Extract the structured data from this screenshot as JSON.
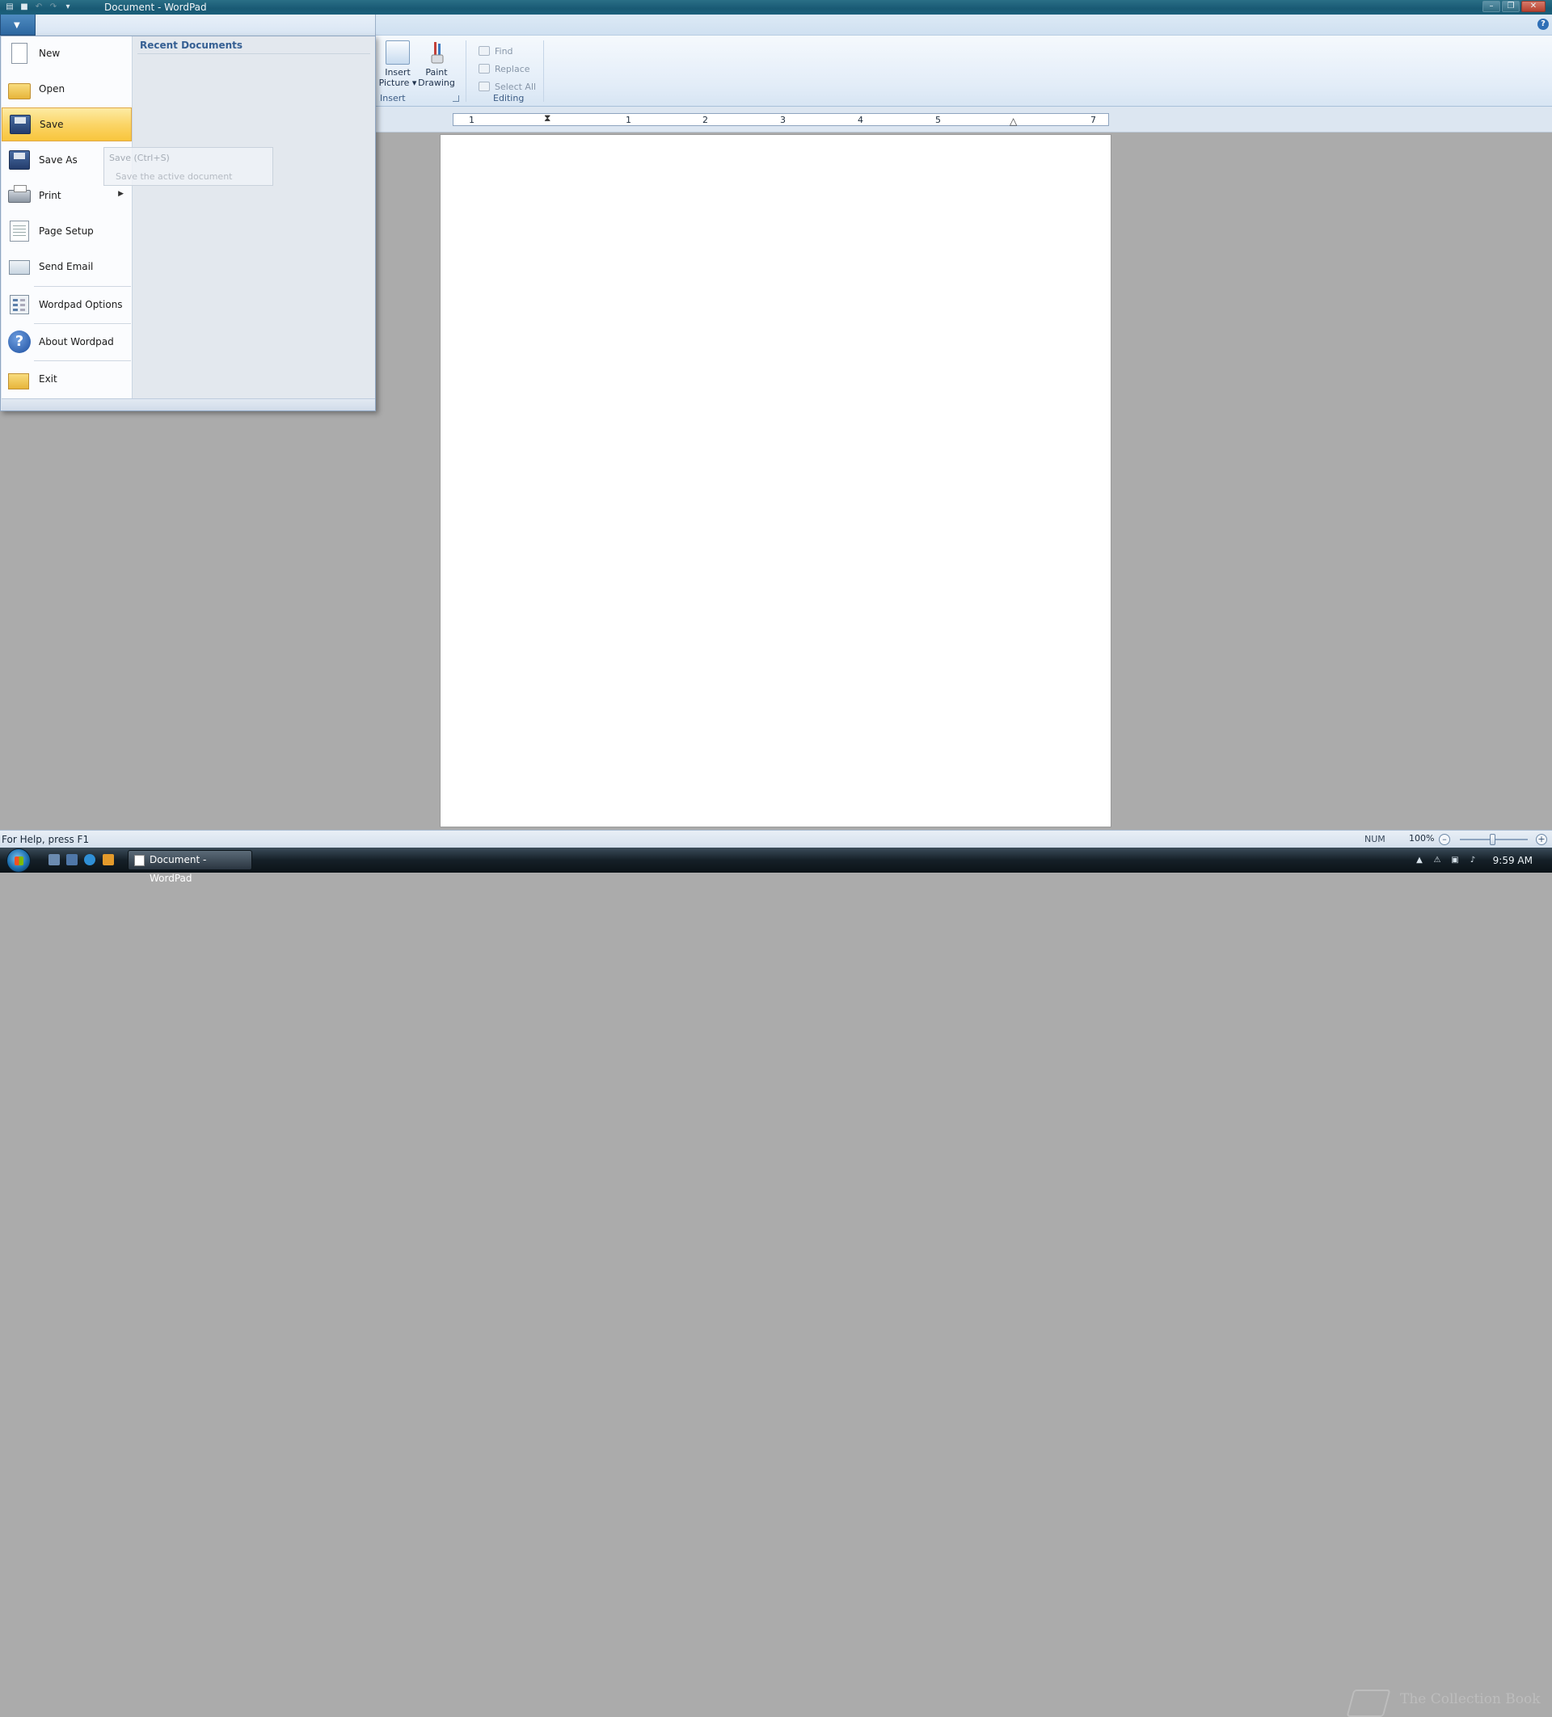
{
  "window": {
    "title": "Document - WordPad"
  },
  "qat": {
    "icons": [
      "save-icon",
      "undo-icon",
      "redo-icon",
      "customize-icon"
    ]
  },
  "ribbon": {
    "insert_group": {
      "label": "Insert",
      "insert_picture_line1": "Insert",
      "insert_picture_line2": "Picture",
      "paint_drawing_line1": "Paint",
      "paint_drawing_line2": "Drawing"
    },
    "editing_group": {
      "label": "Editing",
      "find": "Find",
      "replace": "Replace",
      "select_all": "Select All"
    }
  },
  "ruler": {
    "numbers": [
      "1",
      "1",
      "2",
      "3",
      "4",
      "5",
      "7"
    ]
  },
  "app_menu": {
    "recent_title": "Recent Documents",
    "items": [
      {
        "label": "New",
        "icon": "new-document-icon"
      },
      {
        "label": "Open",
        "icon": "open-folder-icon"
      },
      {
        "label": "Save",
        "icon": "save-floppy-icon",
        "active": true
      },
      {
        "label": "Save As",
        "icon": "save-as-icon"
      },
      {
        "label": "Print",
        "icon": "printer-icon",
        "submenu": true
      },
      {
        "label": "Page Setup",
        "icon": "page-setup-icon"
      },
      {
        "label": "Send Email",
        "icon": "email-icon"
      },
      {
        "label": "Wordpad Options",
        "icon": "options-icon"
      },
      {
        "label": "About Wordpad",
        "icon": "help-icon"
      },
      {
        "label": "Exit",
        "icon": "exit-icon"
      }
    ]
  },
  "tooltip": {
    "title": "Save (Ctrl+S)",
    "description": "Save the active document"
  },
  "statusbar": {
    "help_text": "For Help, press F1",
    "num_indicator": "NUM",
    "zoom": "100%"
  },
  "taskbar": {
    "active_window": "Document - WordPad",
    "clock": "9:59 AM"
  },
  "watermark": {
    "text": "The Collection Book"
  },
  "colors": {
    "title_bar": "#195a74",
    "menu_highlight": "#fbd567",
    "accent": "#2f6fb6"
  }
}
